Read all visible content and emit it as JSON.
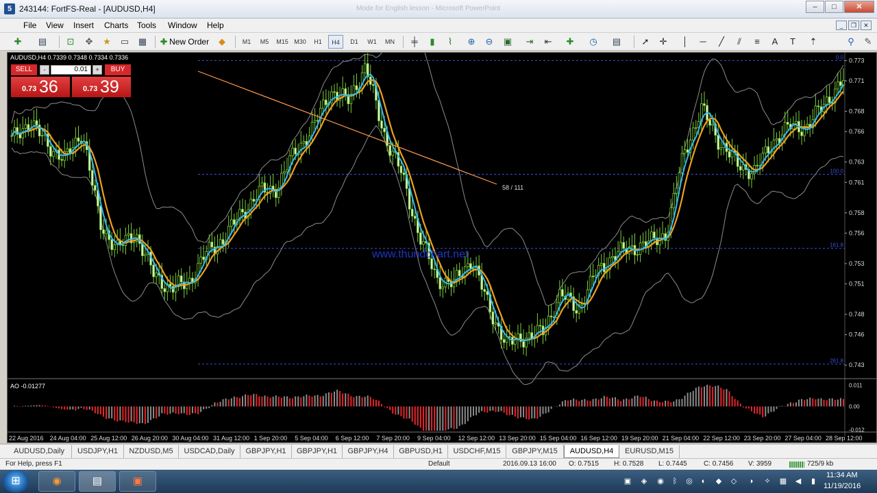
{
  "window": {
    "title": "243144: FortFS-Real - [AUDUSD,H4]",
    "app_icon": "mt4-icon",
    "bg_title": "Mode for English lesson - Microsoft PowerPoint",
    "controls": [
      "–",
      "□",
      "✕"
    ]
  },
  "menu": {
    "items": [
      "File",
      "View",
      "Insert",
      "Charts",
      "Tools",
      "Window",
      "Help"
    ]
  },
  "toolbar": {
    "new_order": "New Order",
    "timeframes": [
      "M1",
      "M5",
      "M15",
      "M30",
      "H1",
      "H4",
      "D1",
      "W1",
      "MN"
    ],
    "active_timeframe": "H4"
  },
  "chart": {
    "header": "AUDUSD,H4  0.7339 0.7348 0.7334 0.7336",
    "sell_label": "SELL",
    "buy_label": "BUY",
    "lot": "0.01",
    "lot_minus": "-",
    "lot_plus": "+",
    "sell_prefix": "0.73",
    "sell_big": "36",
    "buy_prefix": "0.73",
    "buy_big": "39",
    "watermark": "www.thundchart.net",
    "ratio_label": "58 / 111",
    "ao_label": "AO -0.01277",
    "colors": {
      "background": "#000000",
      "candle_up": "#7dcf3a",
      "ma_blue": "#35b8f0",
      "ma_orange": "#f0a020",
      "band": "#8c8c8c",
      "fib": "#3c50d8",
      "trendline": "#ff9a4a",
      "ao_up": "#8c8c8c",
      "ao_down": "#e8262a"
    }
  },
  "chart_data": {
    "type": "candlestick",
    "symbol": "AUDUSD",
    "timeframe": "H4",
    "ohlc_last": {
      "open": 0.7339,
      "high": 0.7348,
      "low": 0.7334,
      "close": 0.7336
    },
    "ylim": [
      0.7418,
      0.7735
    ],
    "price_ticks": [
      "0.773",
      "0.771",
      "0.768",
      "0.766",
      "0.763",
      "0.761",
      "0.758",
      "0.756",
      "0.753",
      "0.751",
      "0.748",
      "0.746",
      "0.743"
    ],
    "time_ticks": [
      "22 Aug 2016",
      "24 Aug 04:00",
      "25 Aug 12:00",
      "26 Aug 20:00",
      "30 Aug 04:00",
      "31 Aug 12:00",
      "1 Sep 20:00",
      "5 Sep 04:00",
      "6 Sep 12:00",
      "7 Sep 20:00",
      "9 Sep 04:00",
      "12 Sep 12:00",
      "13 Sep 20:00",
      "15 Sep 04:00",
      "16 Sep 12:00",
      "19 Sep 20:00",
      "21 Sep 04:00",
      "22 Sep 12:00",
      "23 Sep 20:00",
      "27 Sep 04:00",
      "28 Sep 12:00"
    ],
    "fib_levels": [
      {
        "label": "0.0",
        "price": 0.773
      },
      {
        "label": "100.0",
        "price": 0.7618
      },
      {
        "label": "161.8",
        "price": 0.7545
      },
      {
        "label": "261.8",
        "price": 0.7431
      }
    ],
    "ao": {
      "label": "AO -0.01277",
      "ticks": [
        "0.011",
        "0.00",
        "-0.012"
      ],
      "range": [
        -0.0125,
        0.0115
      ]
    },
    "close_path": [
      0.7652,
      0.767,
      0.7648,
      0.7632,
      0.766,
      0.7568,
      0.7545,
      0.756,
      0.752,
      0.7505,
      0.7512,
      0.754,
      0.7555,
      0.758,
      0.76,
      0.7605,
      0.764,
      0.7662,
      0.77,
      0.769,
      0.7724,
      0.766,
      0.762,
      0.756,
      0.7515,
      0.751,
      0.7535,
      0.7485,
      0.745,
      0.7458,
      0.7462,
      0.75,
      0.7485,
      0.752,
      0.7538,
      0.7545,
      0.755,
      0.756,
      0.764,
      0.7682,
      0.765,
      0.7628,
      0.762,
      0.765,
      0.7665,
      0.7665,
      0.769,
      0.771
    ]
  },
  "tabs": [
    "AUDUSD,Daily",
    "USDJPY,H1",
    "NZDUSD,M5",
    "USDCAD,Daily",
    "GBPJPY,H1",
    "GBPJPY,H1",
    "GBPJPY,H4",
    "GBPUSD,H1",
    "USDCHF,M15",
    "GBPJPY,M15",
    "AUDUSD,H4",
    "EURUSD,M15"
  ],
  "active_tab": "AUDUSD,H4",
  "status": {
    "help": "For Help, press F1",
    "profile": "Default",
    "datetime": "2016.09.13 16:00",
    "open": "O: 0.7515",
    "high": "H: 0.7528",
    "low": "L: 0.7445",
    "close": "C: 0.7456",
    "volume": "V: 3959",
    "traffic": "725/9 kb"
  },
  "taskbar": {
    "time": "11:34 AM",
    "date": "11/19/2016"
  }
}
